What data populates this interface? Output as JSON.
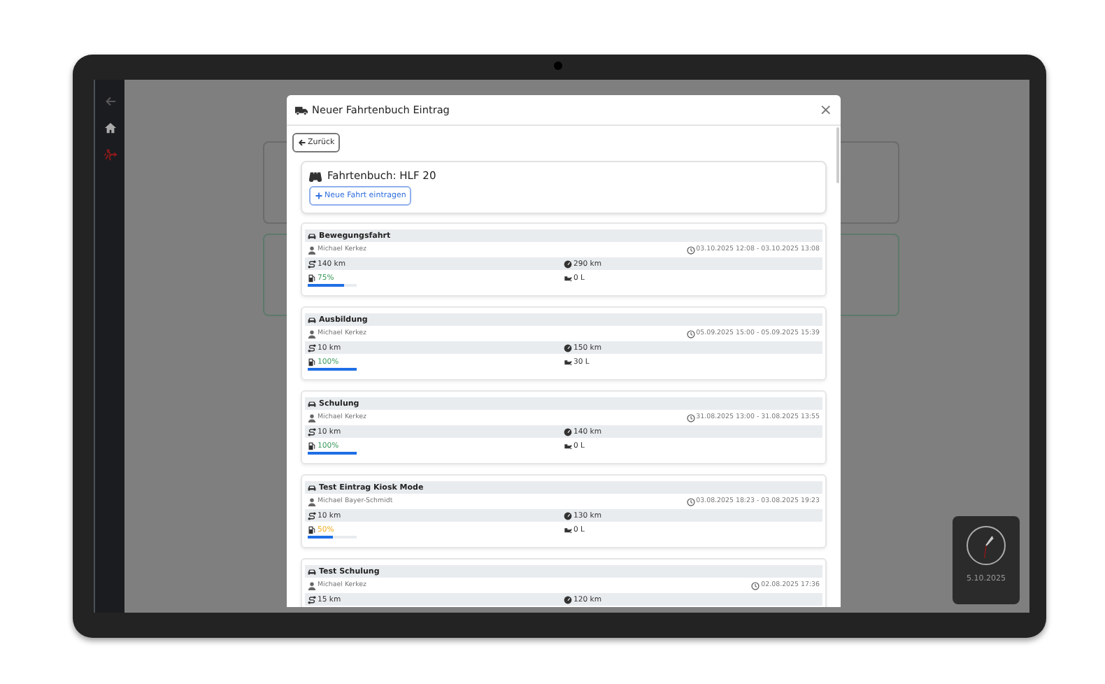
{
  "modal": {
    "title": "Neuer Fahrtenbuch Eintrag",
    "close": "×",
    "back_button": "Zurück",
    "logbook_title": "Fahrtenbuch: HLF 20",
    "new_trip_button": "Neue Fahrt eintragen"
  },
  "entries": [
    {
      "title": "Bewegungsfahrt",
      "driver": "Michael Kerkez",
      "time": "03.10.2025 12:08 - 03.10.2025 13:08",
      "distance": "140 km",
      "odometer": "290 km",
      "fuel": "75%",
      "level": 0.75,
      "refuel": "0 L"
    },
    {
      "title": "Ausbildung",
      "driver": "Michael Kerkez",
      "time": "05.09.2025 15:00 - 05.09.2025 15:39",
      "distance": "10 km",
      "odometer": "150 km",
      "fuel": "100%",
      "level": 1,
      "refuel": "30 L"
    },
    {
      "title": "Schulung",
      "driver": "Michael Kerkez",
      "time": "31.08.2025 13:00 - 31.08.2025 13:55",
      "distance": "10 km",
      "odometer": "140 km",
      "fuel": "100%",
      "level": 1,
      "refuel": "0 L"
    },
    {
      "title": "Test Eintrag Kiosk Mode",
      "driver": "Michael Bayer-Schmidt",
      "time": "03.08.2025 18:23 - 03.08.2025 19:23",
      "distance": "10 km",
      "odometer": "130 km",
      "fuel": "50%",
      "level": 0.5,
      "refuel": "0 L"
    },
    {
      "title": "Test Schulung",
      "driver": "Michael Kerkez",
      "time": "02.08.2025 17:36",
      "distance": "15 km",
      "odometer": "120 km"
    }
  ],
  "clock": {
    "date": "5.10.2025"
  }
}
